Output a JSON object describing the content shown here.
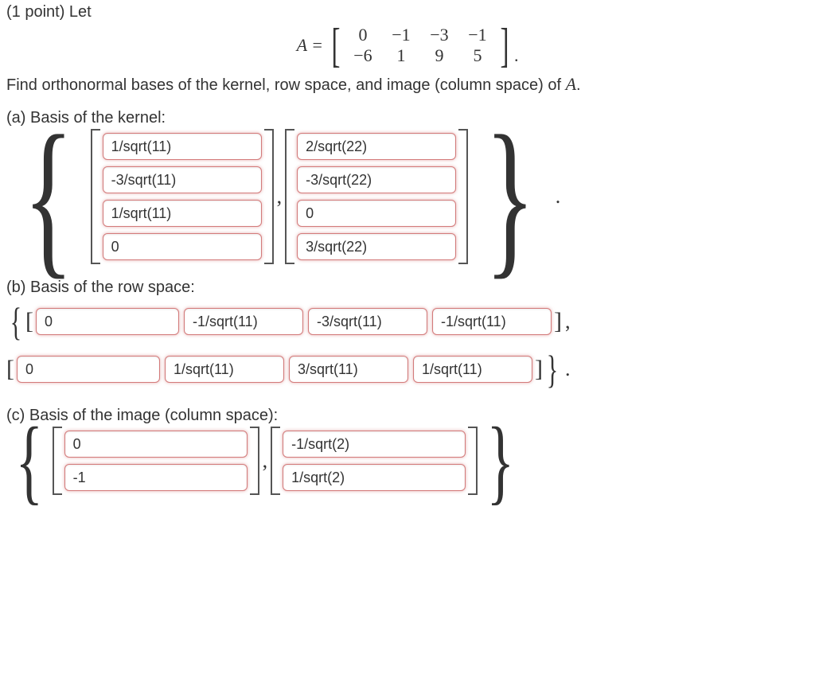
{
  "prefix": "(1 point) Let",
  "matrix_label": "A =",
  "matrix": [
    [
      "0",
      "−1",
      "−3",
      "−1"
    ],
    [
      "−6",
      "1",
      "9",
      "5"
    ]
  ],
  "matrix_suffix": ".",
  "instruction": "Find orthonormal bases of the kernel, row space, and image (column space) of A.",
  "a": {
    "label": "(a) Basis of the kernel:",
    "v1": [
      "1/sqrt(11)",
      "-3/sqrt(11)",
      "1/sqrt(11)",
      "0"
    ],
    "v2": [
      "2/sqrt(22)",
      "-3/sqrt(22)",
      "0",
      "3/sqrt(22)"
    ]
  },
  "b": {
    "label": "(b) Basis of the row space:",
    "r1": [
      "0",
      "-1/sqrt(11)",
      "-3/sqrt(11)",
      "-1/sqrt(11)"
    ],
    "r2": [
      "0",
      "1/sqrt(11)",
      "3/sqrt(11)",
      "1/sqrt(11)"
    ]
  },
  "c": {
    "label": "(c) Basis of the image (column space):",
    "v1": [
      "0",
      "-1"
    ],
    "v2": [
      "-1/sqrt(2)",
      "1/sqrt(2)"
    ]
  },
  "chart_data": {
    "type": "table",
    "title": "Matrix A and orthonormal bases",
    "matrix_A": [
      [
        0,
        -1,
        -3,
        -1
      ],
      [
        -6,
        1,
        9,
        5
      ]
    ],
    "kernel_basis": [
      [
        "1/sqrt(11)",
        "-3/sqrt(11)",
        "1/sqrt(11)",
        "0"
      ],
      [
        "2/sqrt(22)",
        "-3/sqrt(22)",
        "0",
        "3/sqrt(22)"
      ]
    ],
    "row_space_basis": [
      [
        "0",
        "-1/sqrt(11)",
        "-3/sqrt(11)",
        "-1/sqrt(11)"
      ],
      [
        "0",
        "1/sqrt(11)",
        "3/sqrt(11)",
        "1/sqrt(11)"
      ]
    ],
    "column_space_basis": [
      [
        "0",
        "-1"
      ],
      [
        "-1/sqrt(2)",
        "1/sqrt(2)"
      ]
    ]
  }
}
